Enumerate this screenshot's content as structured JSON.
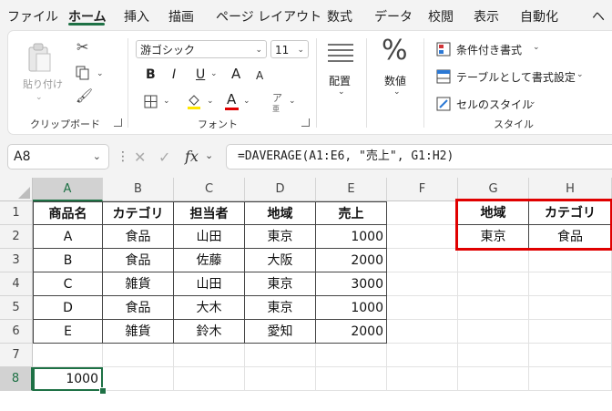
{
  "ribbon_tabs": [
    "ファイル",
    "ホーム",
    "挿入",
    "描画",
    "ページ レイアウト",
    "数式",
    "データ",
    "校閲",
    "表示",
    "自動化",
    "ヘ"
  ],
  "active_tab": "ホーム",
  "accent_color": "#1e7145",
  "ribbon": {
    "clipboard": {
      "paste_label": "貼り付け",
      "group_label": "クリップボード"
    },
    "font": {
      "font_name": "游ゴシック",
      "font_size": "11",
      "group_label": "フォント",
      "bold": "B",
      "italic": "I",
      "underline": "U",
      "grow": "A",
      "shrink": "A",
      "font_color": "A"
    },
    "alignment": {
      "label": "配置"
    },
    "number": {
      "symbol": "%",
      "label": "数値"
    },
    "styles": {
      "conditional": "条件付き書式",
      "table": "テーブルとして書式設定",
      "cell_styles": "セルのスタイル",
      "group_label": "スタイル"
    }
  },
  "formula_bar": {
    "name_box": "A8",
    "fx": "fx",
    "formula": "=DAVERAGE(A1:E6, \"売上\", G1:H2)"
  },
  "sheet": {
    "columns": [
      "A",
      "B",
      "C",
      "D",
      "E",
      "F",
      "G",
      "H"
    ],
    "rows": [
      "1",
      "2",
      "3",
      "4",
      "5",
      "6",
      "7",
      "8"
    ],
    "header": [
      "商品名",
      "カテゴリ",
      "担当者",
      "地域",
      "売上"
    ],
    "data": [
      [
        "A",
        "食品",
        "山田",
        "東京",
        "1000"
      ],
      [
        "B",
        "食品",
        "佐藤",
        "大阪",
        "2000"
      ],
      [
        "C",
        "雑貨",
        "山田",
        "東京",
        "3000"
      ],
      [
        "D",
        "食品",
        "大木",
        "東京",
        "1000"
      ],
      [
        "E",
        "雑貨",
        "鈴木",
        "愛知",
        "2000"
      ]
    ],
    "criteria_header": [
      "地域",
      "カテゴリ"
    ],
    "criteria_values": [
      "東京",
      "食品"
    ],
    "result_cell": "1000",
    "criteria_highlight_color": "#e00000",
    "selection_color": "#1e7145"
  }
}
